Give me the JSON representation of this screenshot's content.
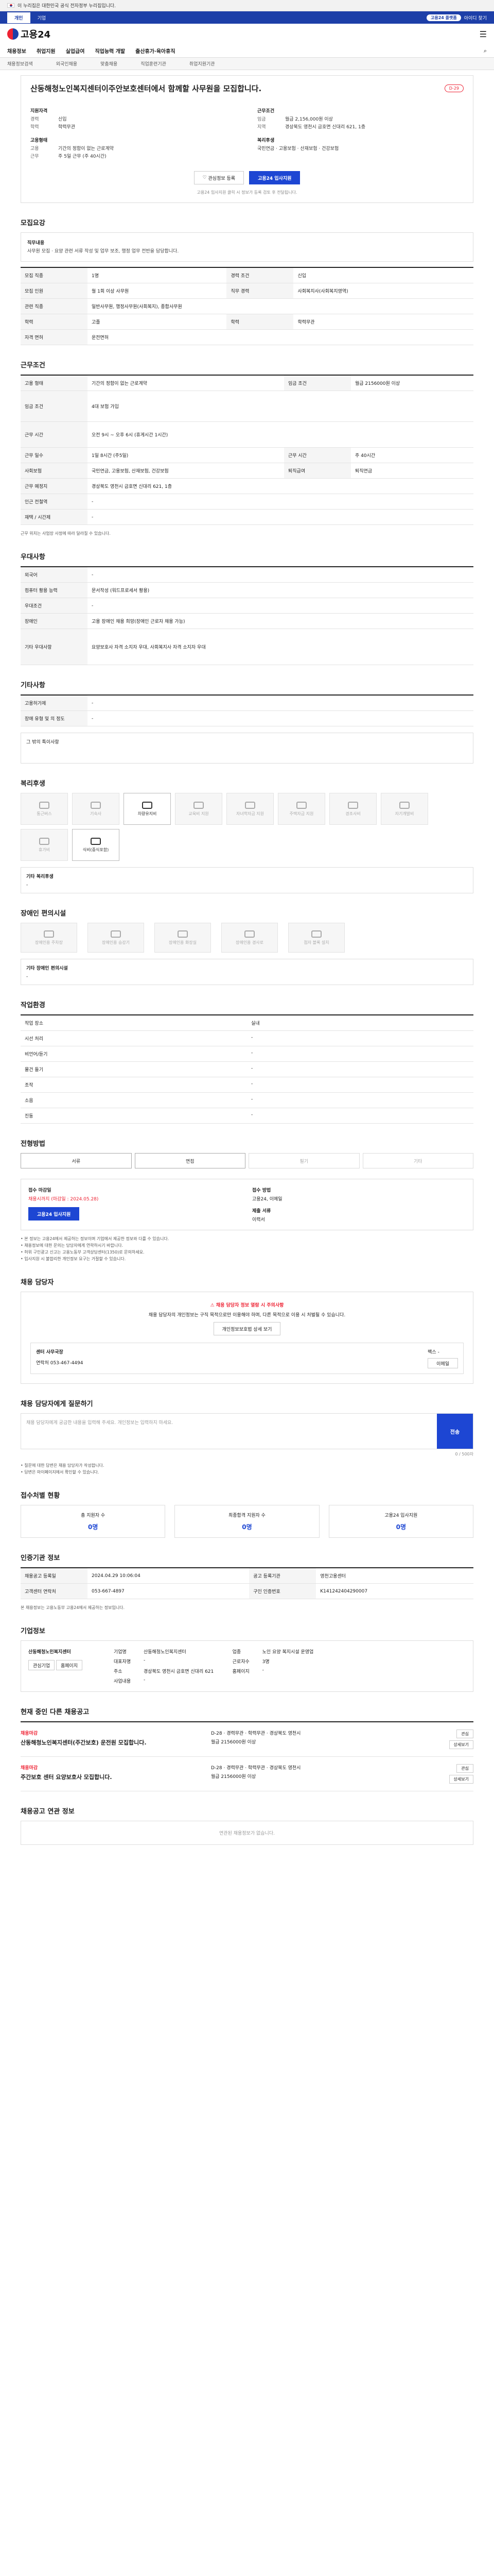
{
  "gov_bar": {
    "text": "이 누리집은 대한민국 공식 전자정부 누리집입니다."
  },
  "top": {
    "tabs": [
      "개인",
      "기업"
    ],
    "right_pill": "고용24 플랫폼",
    "right_text": "아이디 찾기"
  },
  "header": {
    "logo": "고용24"
  },
  "nav": {
    "items": [
      "채용정보",
      "취업지원",
      "실업급여",
      "직업능력 개발",
      "출산휴가·육아휴직"
    ],
    "sub": [
      "채용정보검색",
      "외국인채용",
      "맞춤채용",
      "직업훈련기관",
      "취업지원기관"
    ]
  },
  "job": {
    "title": "산동해청노인복지센터이주안보호센터에서 함께할 사무원을 모집합니다.",
    "badge": "D-29",
    "left_group": "지원자격",
    "career_label": "경력",
    "career_value": "신입",
    "edu_label": "학력",
    "edu_value": "학력무관",
    "cond_group": "고용형태",
    "cond_type_label": "고용",
    "cond_type_value": "기간의 정함이 없는 근로계약",
    "cond_hours_label": "근무",
    "cond_hours_value": "주 5일 근무 (주 40시간)",
    "right_group": "근무조건",
    "pay_label": "임금",
    "pay_value": "월급 2,156,000원 이상",
    "place_label": "지역",
    "place_value": "경상북도 영천시 금호면 신대리 621, 1층",
    "welfare_group": "복리후생",
    "welfare_value": "국민연금 · 고용보험 · 산재보험 · 건강보험",
    "btn_interest": "관심정보 등록",
    "btn_apply": "고용24 입사지원",
    "notice": "고용24 입사지원 클릭 시 정보가 등록 검토 후 전달됩니다."
  },
  "sections": {
    "duties": "모집요강",
    "conditions": "근무조건",
    "preference": "우대사항",
    "other": "기타사항",
    "welfare": "복리후생",
    "facility": "장애인 편의시설",
    "environment": "작업환경",
    "senses": "전형방법",
    "apply": "채용 담당자",
    "question": "채용 담당자에게 질문하기",
    "stats": "접수처별 현황",
    "registry": "인증기관 정보",
    "company": "기업정보",
    "others": "현재 중인 다른 채용공고",
    "similar": "채용공고 연관 정보"
  },
  "duties": {
    "sub": "직무내용",
    "text": "사무원 모집 · 요양 관련 서류 작성 및 업무 보조, 행정 업무 전반을 담당합니다.",
    "rows": [
      {
        "k": "모집 직종",
        "v": "1명",
        "k2": "경력 조건",
        "v2": "신입"
      },
      {
        "k": "모집 인원",
        "v": "월 1회 이상 사무원",
        "k2": "직무 경력",
        "v2": "사회복지사(사회복지영역)"
      },
      {
        "k": "관련 직종",
        "v": "일반사무원, 행정사무원(사회복지), 종합사무원",
        "k2": "",
        "v2": ""
      },
      {
        "k": "학력",
        "v": "고졸",
        "k2": "학력",
        "v2": "학력무관"
      },
      {
        "k": "자격 면허",
        "v": "운전면허",
        "k2": "",
        "v2": ""
      }
    ]
  },
  "conditions": {
    "rows": [
      {
        "k": "고용 형태",
        "v": "기간의 정함이 없는 근로계약",
        "k2": "임금 조건",
        "v2": "월급 2156000원 이상"
      },
      {
        "k": "임금 조건",
        "v": "4대 보험 가입",
        "k2": "",
        "v2": ""
      },
      {
        "k": "근무 시간",
        "v": "오전 9시 ~ 오후 6시 (휴게시간 1시간)",
        "k2": "",
        "v2": ""
      },
      {
        "k": "근무 일수",
        "v": "1일 8시간 (주5일)",
        "k2": "근무 시간",
        "v2": "주 40시간"
      },
      {
        "k": "사회보험",
        "v": "국민연금, 고용보험, 산재보험, 건강보험",
        "k2": "퇴직급여",
        "v2": "퇴직연금"
      },
      {
        "k": "근무 예정지",
        "v": "경상북도 영천시 금호면 신대리 621, 1층",
        "k2": "",
        "v2": ""
      },
      {
        "k": "인근 전철역",
        "v": "-",
        "k2": "",
        "v2": ""
      },
      {
        "k": "재택 / 시간제",
        "v": "-",
        "k2": "",
        "v2": ""
      }
    ],
    "note": "근무 위치는 사업장 사정에 따라 달라질 수 있습니다."
  },
  "preference": {
    "rows": [
      {
        "k": "외국어",
        "v": "-"
      },
      {
        "k": "컴퓨터 활용 능력",
        "v": "문서작성 (워드프로세서 활용)"
      },
      {
        "k": "우대조건",
        "v": "-"
      },
      {
        "k": "장애인",
        "v": "고용 장애인 채용 희망(장애인 근로자 채용 가능)"
      },
      {
        "k": "기타 우대사항",
        "v": "요양보호사 자격 소지자 우대, 사회복지사 자격 소지자 우대"
      }
    ]
  },
  "other": {
    "rows": [
      {
        "k": "고용허가제",
        "v": "-"
      },
      {
        "k": "장애 유형 및 의 정도",
        "v": "-"
      }
    ],
    "extra": "그 밖의 특이사항"
  },
  "welfare": {
    "icons": [
      "통근버스",
      "기숙사",
      "차량유지비",
      "교육비 지원",
      "자녀학자금 지원",
      "주택자금 지원",
      "경조사비",
      "자기개발비",
      "휴가비",
      "식비(중식포함)"
    ],
    "on": [
      2,
      9
    ],
    "extra_label": "기타 복리후생",
    "extra_value": "-"
  },
  "facility": {
    "icons": [
      "장애인용 주차장",
      "장애인용 승강기",
      "장애인용 화장실",
      "장애인용 경사로",
      "점자 블록 설치"
    ],
    "extra_label": "기타 장애인 편의시설",
    "extra_value": "-"
  },
  "environment": {
    "rows": [
      {
        "k": "작업 장소",
        "v": "실내",
        "k2": "",
        "v2": ""
      },
      {
        "k": "시선 처리",
        "v": "-",
        "k2": "비언어/듣기",
        "v2": "-"
      },
      {
        "k": "물건 들기",
        "v": "-",
        "k2": "조작",
        "v2": "-"
      },
      {
        "k": "소음",
        "v": "-",
        "k2": "진동",
        "v2": "-"
      }
    ]
  },
  "senses": {
    "items": [
      "서류",
      "면접",
      "필기",
      "기타"
    ],
    "on": [
      0,
      1
    ]
  },
  "apply": {
    "label1": "접수 마감일",
    "value1": "채용시까지 (마감일 : 2024.05.28)",
    "label2": "접수 방법",
    "value2": "고용24, 이메일",
    "label3": "제출 서류",
    "value3": "이력서",
    "btn": "고용24 입사지원",
    "bullets": [
      "• 본 정보는 고용24에서 제공하는 정보이며 기업에서 제공한 정보와 다를 수 있습니다.",
      "• 채용정보에 대한 문의는 담당자에게 연락하시기 바랍니다.",
      "• 허위 구인광고 신고는 고용노동부 고객상담센터(1350)로 문의하세요.",
      "• 입사지원 시 불합리한 개인정보 요구는 거절할 수 있습니다."
    ]
  },
  "manager": {
    "warn": "채용 담당자 정보 열람 시 주의사항",
    "text": "채용 담당자의 개인정보는 구직 목적으로만 이용해야 하며, 다른 목적으로 이용 시 처벌될 수 있습니다.",
    "btn": "개인정보보호법 상세 보기",
    "name_label": "센터 사무국장",
    "tel_label": "연락처",
    "tel": "053-467-4494",
    "fax_label": "팩스",
    "fax": "-",
    "email_btn": "이메일"
  },
  "question": {
    "placeholder": "채용 담당자에게 궁금한 내용을 입력해 주세요. 개인정보는 입력하지 마세요.",
    "send": "전송",
    "count": "0 / 500자",
    "tips": [
      "• 질문에 대한 답변은 채용 담당자가 작성합니다.",
      "• 답변은 마이페이지에서 확인할 수 있습니다."
    ]
  },
  "stats": {
    "items": [
      {
        "t": "총 지원자 수",
        "v": "0명"
      },
      {
        "t": "최종합격 지원자 수",
        "v": "0명"
      },
      {
        "t": "고용24 입사지원",
        "v": "0명"
      }
    ]
  },
  "registry": {
    "rows": [
      {
        "k": "채용공고 등록일",
        "v": "2024.04.29 10:06:04",
        "k2": "공고 등록기관",
        "v2": "영천고용센터"
      },
      {
        "k": "고객센터 연락처",
        "v": "053-667-4897",
        "k2": "구인 인증번호",
        "v2": "K141242404290007"
      }
    ],
    "note": "본 채용정보는 고용노동부 고용24에서 제공하는 정보입니다."
  },
  "company": {
    "name": "산동해청노인복지센터",
    "btn1": "관심기업",
    "btn2": "홈페이지",
    "rows": [
      [
        "기업명",
        "산동해청노인복지센터",
        "업종",
        "노인 요양 복지시설 운영업"
      ],
      [
        "대표자명",
        "-",
        "근로자수",
        "3명"
      ],
      [
        "주소",
        "경상북도 영천시 금호면 신대리 621",
        "홈페이지",
        "-"
      ],
      [
        "사업내용",
        "-",
        "",
        ""
      ]
    ]
  },
  "others": {
    "items": [
      {
        "co": "채용마감",
        "title": "산동해청노인복지센터(주간보호) 운전원 모집합니다.",
        "meta": "D-28 · 경력무관 · 학력무관 · 경상북도 영천시",
        "pay": "월급 2156000원 이상"
      },
      {
        "co": "채용마감",
        "title": "주간보호 센터 요양보호사 모집합니다.",
        "meta": "D-28 · 경력무관 · 학력무관 · 경상북도 영천시",
        "pay": "월급 2156000원 이상"
      }
    ],
    "btn_a": "관심",
    "btn_b": "상세보기"
  },
  "similar": {
    "empty": "연관된 채용정보가 없습니다."
  }
}
